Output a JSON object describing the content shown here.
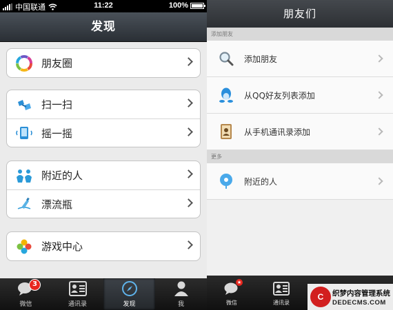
{
  "left": {
    "status_bar": {
      "carrier": "中国联通",
      "time": "11:22",
      "battery": "100%"
    },
    "nav_title": "发现",
    "groups": [
      [
        {
          "label": "朋友圈",
          "icon": "moments-icon"
        }
      ],
      [
        {
          "label": "扫一扫",
          "icon": "scan-icon"
        },
        {
          "label": "摇一摇",
          "icon": "shake-icon"
        }
      ],
      [
        {
          "label": "附近的人",
          "icon": "people-nearby-icon"
        },
        {
          "label": "漂流瓶",
          "icon": "drift-bottle-icon"
        }
      ],
      [
        {
          "label": "游戏中心",
          "icon": "game-center-icon"
        }
      ]
    ],
    "tabs": [
      {
        "label": "微信",
        "badge": "3",
        "icon": "chat-icon"
      },
      {
        "label": "通讯录",
        "icon": "contacts-icon"
      },
      {
        "label": "发现",
        "icon": "compass-icon",
        "active": true
      },
      {
        "label": "我",
        "icon": "person-icon"
      }
    ]
  },
  "right": {
    "nav_title": "朋友们",
    "sections": [
      {
        "header": "添加朋友",
        "rows": [
          {
            "label": "添加朋友",
            "icon": "search-icon"
          },
          {
            "label": "从QQ好友列表添加",
            "icon": "qq-penguin-icon"
          },
          {
            "label": "从手机通讯录添加",
            "icon": "address-book-icon"
          }
        ]
      },
      {
        "header": "更多",
        "rows": [
          {
            "label": "附近的人",
            "icon": "location-pin-icon"
          }
        ]
      }
    ],
    "tabs": [
      {
        "label": "微信",
        "badge": "★",
        "icon": "chat-icon"
      },
      {
        "label": "通讯录",
        "icon": "contacts-icon"
      }
    ]
  },
  "watermark": {
    "line1": "织梦内容管理系统",
    "line2": "DEDECMS.COM",
    "logo": "C"
  }
}
